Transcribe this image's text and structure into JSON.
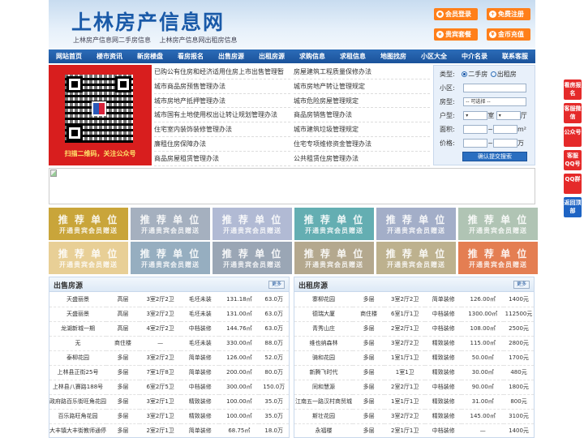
{
  "header": {
    "logo": "上林房产信息网",
    "taglines": [
      "上林房产信息网二手房信息",
      "上林房产信息网出租房信息"
    ],
    "buttons": [
      {
        "label": "会员登录"
      },
      {
        "label": "免费注册"
      },
      {
        "label": "贵宾套餐"
      },
      {
        "label": "金币充值"
      }
    ]
  },
  "nav": [
    "网站首页",
    "楼市资讯",
    "新房楼盘",
    "看房报名",
    "出售房源",
    "出租房源",
    "求购信息",
    "求租信息",
    "地图找房",
    "小区大全",
    "中介名录",
    "联系客服"
  ],
  "qr_caption": "扫描二维码，关注公众号",
  "news_left": [
    "已购公有住房和经济适用住房上市出售管理暂",
    "城市商品房预售管理办法",
    "城市房地产抵押管理办法",
    "城市国有土地使用权出让转让规划管理办法",
    "住宅室内装饰装修管理办法",
    "廉租住房保障办法",
    "商品房屋租赁管理办法"
  ],
  "news_right": [
    "房屋建筑工程质量保修办法",
    "城市房地产转让管理规定",
    "城市危险房屋管理规定",
    "商品房销售管理办法",
    "城市建筑垃圾管理规定",
    "住宅专项维修资金管理办法",
    "公共租赁住房管理办法"
  ],
  "search": {
    "type_label": "类型:",
    "opt1": "二手房",
    "opt2": "出租房",
    "area_label": "小区:",
    "room_label": "房型:",
    "room_select": "-- 可选择 --",
    "layout_label": "户型:",
    "shi": "室",
    "ting": "厅",
    "size_label": "面积:",
    "size_unit": "m²",
    "price_label": "价格:",
    "price_unit": "万",
    "tilde": "~",
    "submit": "确认提交搜索"
  },
  "ads": {
    "title": "推 荐 单 位",
    "sub": "开通贵宾会员赠送",
    "colors": [
      "#c9a53a",
      "#a5b0bf",
      "#b1bad4",
      "#64aeb2",
      "#a3aec8",
      "#b0c4b4",
      "#e8cf96",
      "#96aec0",
      "#9aa6b5",
      "#b4a88e",
      "#bdb18e",
      "#e47e52"
    ]
  },
  "sell": {
    "title": "出售房源",
    "more": "更多",
    "rows": [
      [
        "天盛丽景",
        "高层",
        "3室2厅2卫",
        "毛坯未装",
        "131.18㎡",
        "63.0万"
      ],
      [
        "天盛丽景",
        "高层",
        "3室2厅2卫",
        "毛坯未装",
        "131.00㎡",
        "63.0万"
      ],
      [
        "龙湖新城一期",
        "高层",
        "4室2厅2卫",
        "中档装修",
        "144.76㎡",
        "63.0万"
      ],
      [
        "无",
        "商住楼",
        "—",
        "毛坯未装",
        "330.00㎡",
        "88.0万"
      ],
      [
        "泰柳花园",
        "多层",
        "3室2厅2卫",
        "简单装修",
        "126.00㎡",
        "52.0万"
      ],
      [
        "上林县正街25号",
        "多层",
        "7室1厅8卫",
        "简单装修",
        "200.00㎡",
        "80.0万"
      ],
      [
        "上林县八賽路188号",
        "多层",
        "6室2厅5卫",
        "中档装修",
        "300.00㎡",
        "150.0万"
      ],
      [
        "政府路百乐街旺角花园",
        "多层",
        "3室2厅1卫",
        "精致装修",
        "100.00㎡",
        "35.0万"
      ],
      [
        "百乐路旺角花园",
        "多层",
        "3室2厅1卫",
        "精致装修",
        "100.00㎡",
        "35.0万"
      ],
      [
        "大丰镇大丰街教师通停",
        "多层",
        "2室2厅1卫",
        "简单装修",
        "68.75㎡",
        "18.0万"
      ]
    ]
  },
  "rent": {
    "title": "出租房源",
    "more": "更多",
    "rows": [
      [
        "寨柳花园",
        "多层",
        "3室2厅2卫",
        "简单装修",
        "126.00㎡",
        "1400元"
      ],
      [
        "德瑞大厦",
        "商住楼",
        "6室1厅1卫",
        "中档装修",
        "1300.00㎡",
        "112500元"
      ],
      [
        "青秀山庄",
        "多层",
        "2室2厅1卫",
        "中档装修",
        "108.00㎡",
        "2500元"
      ],
      [
        "维也纳森林",
        "多层",
        "3室2厅2卫",
        "精致装修",
        "115.00㎡",
        "2800元"
      ],
      [
        "骑和花园",
        "多层",
        "1室1厅1卫",
        "精致装修",
        "50.00㎡",
        "1700元"
      ],
      [
        "新腾飞时代",
        "多层",
        "1室1卫",
        "精致装修",
        "30.00㎡",
        "480元"
      ],
      [
        "同和慧源",
        "多层",
        "2室2厅1卫",
        "中档装修",
        "90.00㎡",
        "1800元"
      ],
      [
        "江南五一路汉村商贸城",
        "多层",
        "1室1厅1卫",
        "精致装修",
        "31.00㎡",
        "800元"
      ],
      [
        "斯壮花园",
        "多层",
        "3室2厅2卫",
        "精致装修",
        "145.00㎡",
        "3100元"
      ],
      [
        "永福楼",
        "多层",
        "2室1厅1卫",
        "中档装修",
        "—",
        "1400元"
      ]
    ]
  },
  "float_bar": [
    {
      "label": "看房报名"
    },
    {
      "label": "客服微信"
    },
    {
      "label": "公众号"
    },
    {
      "label": "客服QQ号"
    },
    {
      "label": "QQ群"
    },
    {
      "label": "返回顶部"
    }
  ]
}
